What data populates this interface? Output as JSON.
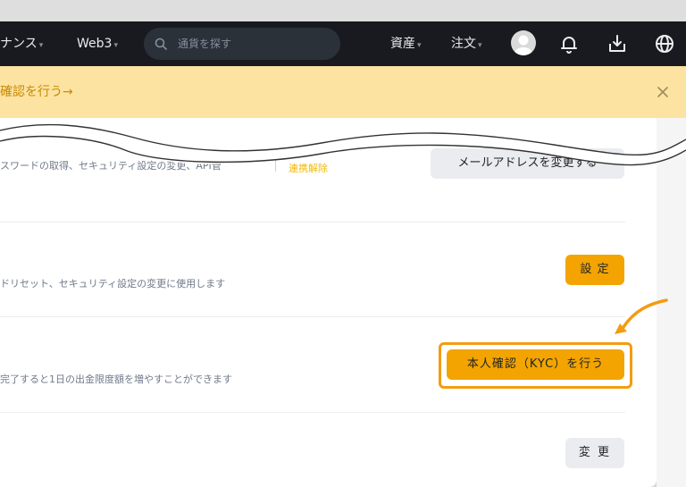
{
  "nav": {
    "link1": "ナンス",
    "link2": "Web3",
    "search_placeholder": "通貨を探す",
    "assets": "資産",
    "orders": "注文",
    "caret": "▾"
  },
  "banner": {
    "text": "確認を行う→",
    "close": "×"
  },
  "rows": [
    {
      "description": "スワードの取得、セキュリティ設定の変更、API管",
      "action_link": "連携解除",
      "button": "メールアドレスを変更する"
    },
    {
      "description": "ドリセット、セキュリティ設定の変更に使用します",
      "button": "設 定"
    },
    {
      "description": "完了すると1日の出金限度額を増やすことができます",
      "button": "本人確認（KYC）を行う"
    },
    {
      "description": "",
      "button": "変 更"
    }
  ],
  "colors": {
    "navbar": "#181a20",
    "banner": "#fce3a2",
    "accent": "#f3a400",
    "highlight": "#f39c12"
  },
  "icons": [
    "search-icon",
    "avatar",
    "bell-icon",
    "download-icon",
    "globe-icon",
    "close-icon",
    "curved-arrow-icon"
  ]
}
